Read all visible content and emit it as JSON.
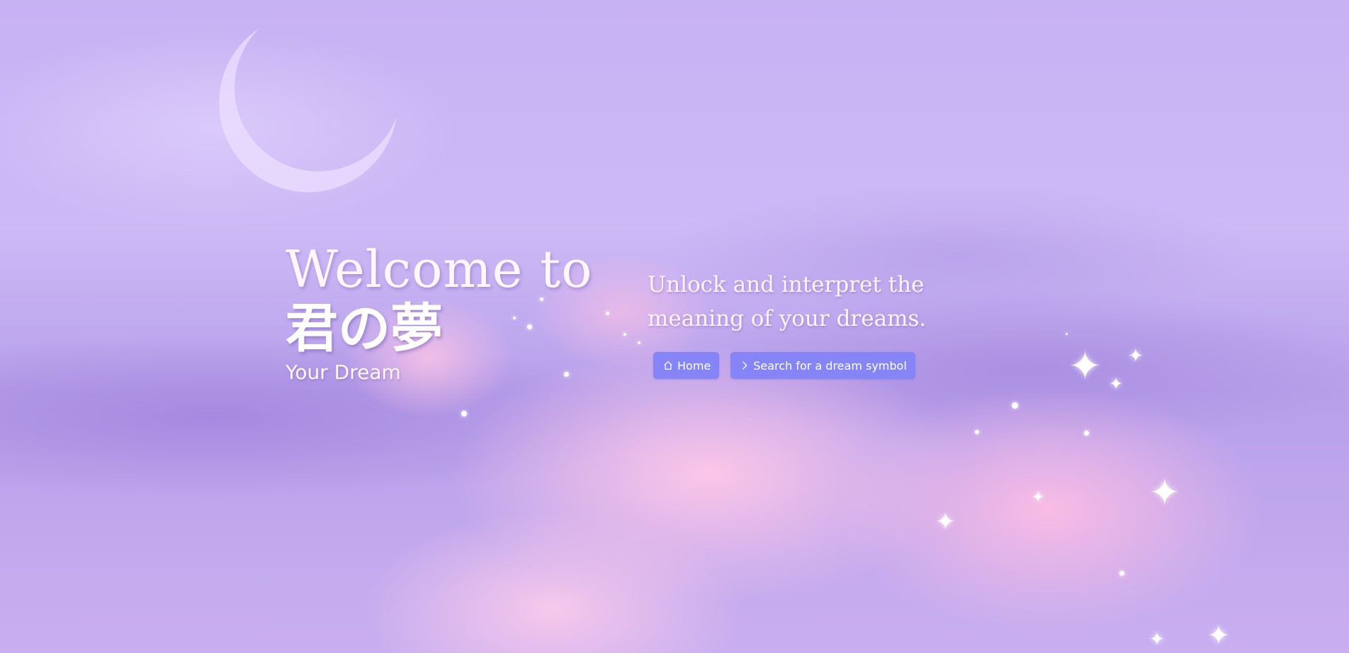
{
  "hero": {
    "welcome": "Welcome to",
    "brand": "君の夢",
    "subtitle": "Your Dream",
    "tagline": "Unlock and interpret the meaning of your dreams."
  },
  "buttons": {
    "home": {
      "label": "Home",
      "icon": "home-icon"
    },
    "search": {
      "label": "Search for a dream symbol",
      "icon": "chevron-right-icon"
    }
  },
  "colors": {
    "button_bg": "#8585f7",
    "sky_top": "#c7b2f3",
    "cloud_pink": "#ffc8e8",
    "cloud_purple": "#a082dc"
  }
}
